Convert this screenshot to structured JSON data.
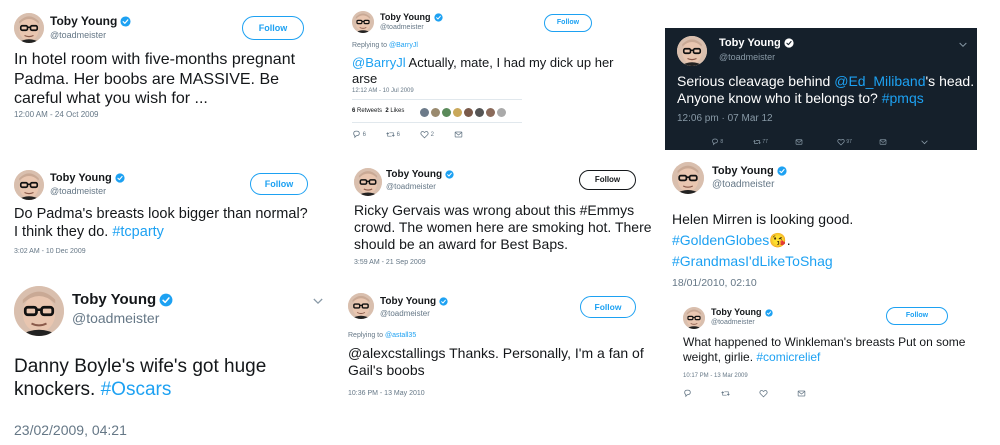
{
  "author": {
    "name": "Toby Young",
    "handle": "@toadmeister"
  },
  "follow_label": "Follow",
  "tweets": [
    {
      "text_plain": "In hotel room with five-months pregnant Padma. Her boobs are MASSIVE. Be careful what you wish for ...",
      "timestamp": "12:00 AM - 24 Oct 2009"
    },
    {
      "reply_label": "Replying to",
      "reply_target": "@BarryJl",
      "mention": "@BarryJl",
      "text_plain": " Actually, mate, I had my dick up her arse",
      "timestamp": "12:12 AM - 10 Jul 2009",
      "retweets_count": "6",
      "retweets_label": "Retweets",
      "likes_count": "2",
      "likes_label": "Likes",
      "reply_count": "6",
      "retweet_count": "6",
      "like_count": "2"
    },
    {
      "text_before": "Serious cleavage behind ",
      "mention": "@Ed_Miliband",
      "text_after": "'s head. Anyone know who it belongs to? ",
      "hashtag": "#pmqs",
      "timestamp": "12:06 pm · 07 Mar 12",
      "reply_count": "8",
      "retweet_count": "77",
      "like_count": "97"
    },
    {
      "text_plain": "Do Padma's breasts look bigger than normal? I think they do. ",
      "hashtag": "#tcparty",
      "timestamp": "3:02 AM - 10 Dec 2009"
    },
    {
      "text_plain": "Ricky Gervais was wrong about this #Emmys crowd. The women here are smoking hot. There should be an award for Best Baps.",
      "timestamp": "3:59 AM - 21 Sep 2009"
    },
    {
      "text_plain": "Helen Mirren is looking good.",
      "hashtag1": "#GoldenGlobes",
      "emoji": "😘",
      "after_emoji": ".",
      "hashtag2": "#GrandmasI'dLikeToShag",
      "timestamp": "18/01/2010, 02:10"
    },
    {
      "text_plain": "Danny Boyle's wife's got huge knockers. ",
      "hashtag": "#Oscars",
      "timestamp": "23/02/2009, 04:21"
    },
    {
      "reply_label": "Replying to",
      "reply_target": "@astall35",
      "text_plain": "@alexcstallings Thanks. Personally, I'm a fan of Gail's boobs",
      "timestamp": "10:36 PM - 13 May 2010"
    },
    {
      "text_plain": "What happened to Winkleman's breasts Put on some weight, girlie. ",
      "hashtag": "#comicrelief",
      "timestamp": "10:17 PM - 13 Mar 2009"
    }
  ],
  "colors": {
    "link": "#1da1f2",
    "verified": "#1da1f2",
    "dark_bg": "#15202b"
  },
  "icons": [
    "verified-icon",
    "chevron-down-icon",
    "reply-icon",
    "retweet-icon",
    "like-icon",
    "dm-icon"
  ]
}
